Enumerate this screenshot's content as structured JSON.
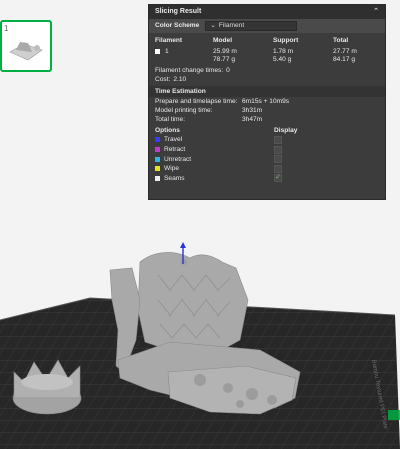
{
  "panel": {
    "title": "Slicing Result",
    "color_scheme_label": "Color Scheme",
    "color_scheme_value": "Filament",
    "filament_table": {
      "headers": [
        "Filament",
        "Model",
        "Support",
        "Total"
      ],
      "row": {
        "id": "1",
        "swatch_color": "#ffffff",
        "model": [
          "25.99 m",
          "78.77 g"
        ],
        "support": [
          "1.78 m",
          "5.40 g"
        ],
        "total": [
          "27.77 m",
          "84.17 g"
        ]
      }
    },
    "filament_change_label": "Filament change times:",
    "filament_change_value": "0",
    "cost_label": "Cost:",
    "cost_value": "2.10",
    "time_section_title": "Time Estimation",
    "times": [
      {
        "label": "Prepare and timelapse time:",
        "value": "6m15s + 10m9s"
      },
      {
        "label": "Model printing time:",
        "value": "3h31m"
      },
      {
        "label": "Total time:",
        "value": "3h47m"
      }
    ],
    "options_header": "Options",
    "display_header": "Display",
    "options": [
      {
        "label": "Travel",
        "color": "#3b3bff",
        "checked": false
      },
      {
        "label": "Retract",
        "color": "#c23bd0",
        "checked": false
      },
      {
        "label": "Unretract",
        "color": "#2fb7e6",
        "checked": false
      },
      {
        "label": "Wipe",
        "color": "#e6e61f",
        "checked": false
      },
      {
        "label": "Seams",
        "color": "#eeeeee",
        "checked": true
      }
    ]
  },
  "plate": {
    "bed_color": "#2b2b2b",
    "grid_color": "#3e3e3e",
    "model_color": "#a7a7a7",
    "accent_color": "#00ae42"
  }
}
